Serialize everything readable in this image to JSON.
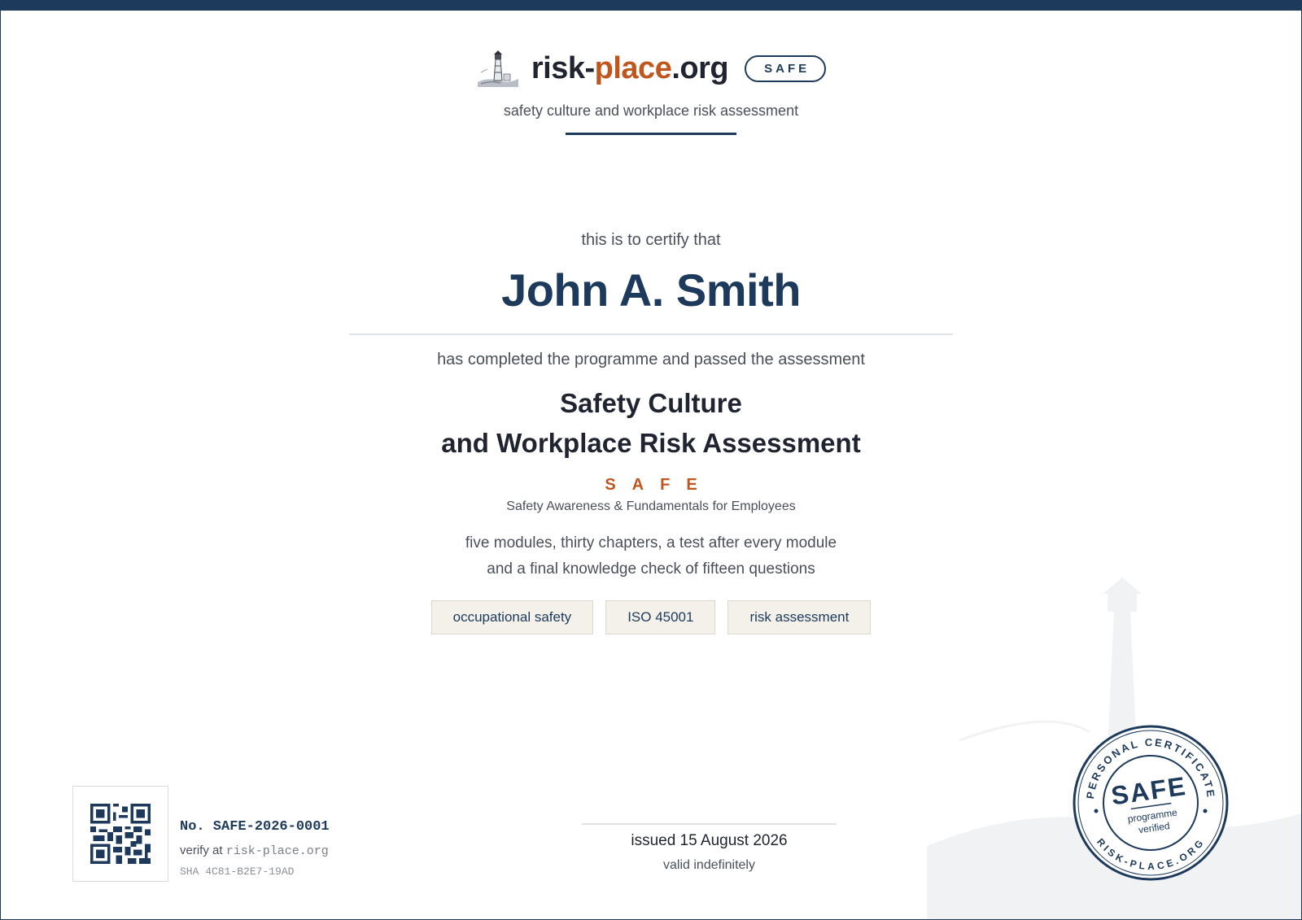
{
  "header": {
    "brand_prefix": "risk-",
    "brand_accent": "place",
    "brand_suffix": ".org",
    "badge": "SAFE",
    "tagline": "safety culture and workplace risk assessment",
    "logo_icon": "lighthouse-icon"
  },
  "certificate": {
    "intro": "this is to certify that",
    "recipient": "John A. Smith",
    "completion_text": "has completed the programme and passed the assessment",
    "course_title_line1": "Safety Culture",
    "course_title_line2": "and Workplace Risk Assessment",
    "acronym": "SAFE",
    "acronym_expansion": "Safety Awareness & Fundamentals for Employees",
    "description_line1": "five modules, thirty chapters, a test after every module",
    "description_line2": "and a final knowledge check of fifteen questions",
    "tags": [
      "occupational safety",
      "ISO 45001",
      "risk assessment"
    ]
  },
  "footer": {
    "serial": "No. SAFE-2026-0001",
    "verify_label": "verify at",
    "verify_url": "risk-place.org",
    "sha": "SHA 4C81-B2E7-19AD",
    "issued": "issued 15 August 2026",
    "validity": "valid indefinitely"
  },
  "seal": {
    "top_text": "PERSONAL CERTIFICATE",
    "bottom_text": "RISK-PLACE.ORG",
    "center_title": "SAFE",
    "center_line1": "programme",
    "center_line2": "verified"
  },
  "colors": {
    "primary": "#1d3a5c",
    "accent": "#c0561d",
    "text": "#1f2430",
    "muted": "#4a4f5a",
    "tag_bg": "#f4f1ea"
  }
}
